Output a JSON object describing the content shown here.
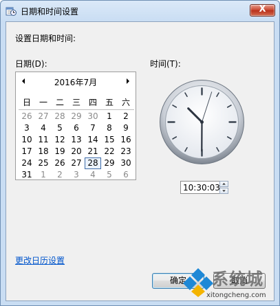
{
  "window": {
    "title": "日期和时间设置",
    "close_symbol": "X"
  },
  "heading": "设置日期和时间:",
  "date": {
    "label": "日期(D):",
    "month_title": "2016年7月",
    "weekdays": [
      "日",
      "一",
      "二",
      "三",
      "四",
      "五",
      "六"
    ],
    "weeks": [
      [
        {
          "d": "26",
          "o": true
        },
        {
          "d": "27",
          "o": true
        },
        {
          "d": "28",
          "o": true
        },
        {
          "d": "29",
          "o": true
        },
        {
          "d": "30",
          "o": true
        },
        {
          "d": "1"
        },
        {
          "d": "2"
        }
      ],
      [
        {
          "d": "3"
        },
        {
          "d": "4"
        },
        {
          "d": "5"
        },
        {
          "d": "6"
        },
        {
          "d": "7"
        },
        {
          "d": "8"
        },
        {
          "d": "9"
        }
      ],
      [
        {
          "d": "10"
        },
        {
          "d": "11"
        },
        {
          "d": "12"
        },
        {
          "d": "13"
        },
        {
          "d": "14"
        },
        {
          "d": "15"
        },
        {
          "d": "16"
        }
      ],
      [
        {
          "d": "17"
        },
        {
          "d": "18"
        },
        {
          "d": "19"
        },
        {
          "d": "20"
        },
        {
          "d": "21"
        },
        {
          "d": "22"
        },
        {
          "d": "23"
        }
      ],
      [
        {
          "d": "24"
        },
        {
          "d": "25"
        },
        {
          "d": "26"
        },
        {
          "d": "27"
        },
        {
          "d": "28",
          "s": true
        },
        {
          "d": "29"
        },
        {
          "d": "30"
        }
      ],
      [
        {
          "d": "31"
        },
        {
          "d": "1",
          "o": true
        },
        {
          "d": "2",
          "o": true
        },
        {
          "d": "3",
          "o": true
        },
        {
          "d": "4",
          "o": true
        },
        {
          "d": "5",
          "o": true
        },
        {
          "d": "6",
          "o": true
        }
      ]
    ],
    "selected_day": "28"
  },
  "time": {
    "label": "时间(T):",
    "value": "10:30:03",
    "clock": {
      "hour": 10,
      "minute": 30,
      "second": 3
    }
  },
  "link": "更改日历设置",
  "buttons": {
    "ok": "确定",
    "cancel": "取消"
  },
  "watermark": {
    "brand": "系统城",
    "url": "xitongcheng.com"
  },
  "colors": {
    "accent": "#0055cc",
    "title_bg": "#c9ddf3",
    "close": "#c7422a"
  }
}
